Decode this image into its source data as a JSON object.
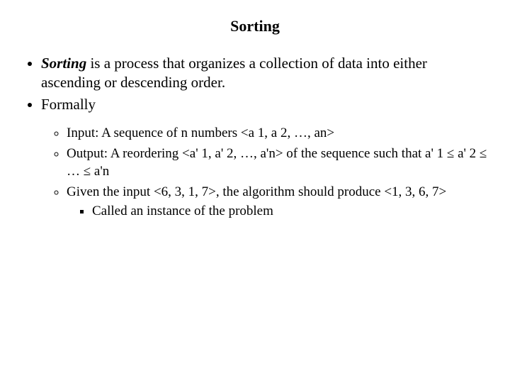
{
  "title": "Sorting",
  "l1": {
    "item1_bolditalic": "Sorting",
    "item1_rest": " is a process that organizes a collection of data into either ascending or descending order.",
    "item2": "Formally"
  },
  "l2": {
    "item1": "Input: A sequence of n numbers <a 1, a 2, …, an>",
    "item2": "Output: A reordering <a' 1, a' 2, …, a'n> of the sequence such that a' 1 ≤ a' 2 ≤ … ≤ a'n",
    "item3": "Given the input <6, 3, 1, 7>, the algorithm should produce <1, 3, 6, 7>"
  },
  "l3": {
    "item1": "Called an instance of the problem"
  }
}
